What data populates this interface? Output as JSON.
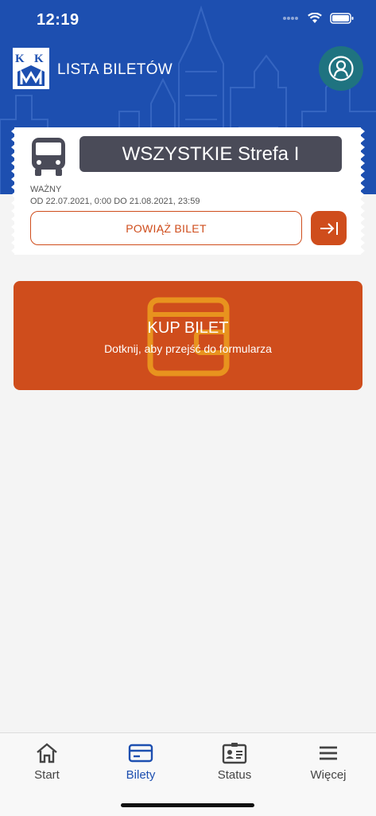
{
  "status_bar": {
    "time": "12:19"
  },
  "header": {
    "title": "LISTA BILETÓW",
    "logo_text": "KKM"
  },
  "ticket": {
    "zone": "WSZYSTKIE Strefa I",
    "valid_label": "WAŻNY",
    "valid_range": "OD 22.07.2021, 0:00 DO 21.08.2021, 23:59",
    "link_button": "POWIĄŻ BILET"
  },
  "buy": {
    "title": "KUP BILET",
    "subtitle": "Dotknij, aby przejść do formularza"
  },
  "tabs": [
    {
      "label": "Start",
      "icon": "home-icon",
      "active": false
    },
    {
      "label": "Bilety",
      "icon": "ticket-icon",
      "active": true
    },
    {
      "label": "Status",
      "icon": "id-card-icon",
      "active": false
    },
    {
      "label": "Więcej",
      "icon": "menu-icon",
      "active": false
    }
  ],
  "colors": {
    "brand_blue": "#1d4fb0",
    "accent_orange": "#cf4d1c",
    "zone_bg": "#4a4b58",
    "profile_teal": "#1f7380"
  }
}
